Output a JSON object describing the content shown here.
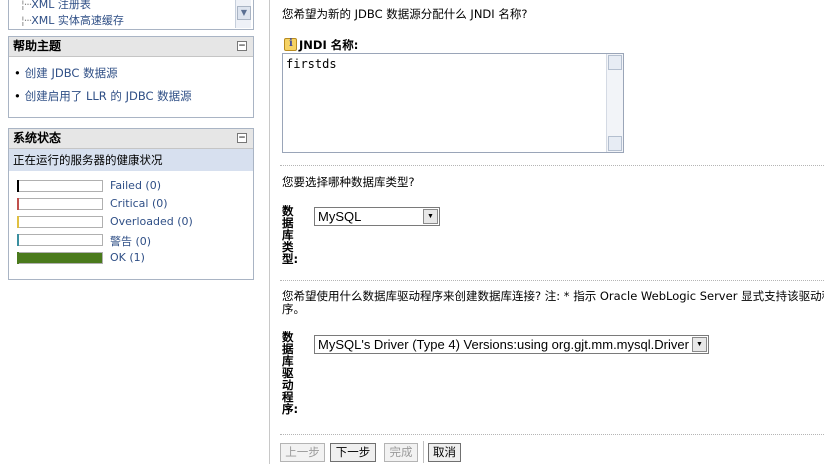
{
  "tree": {
    "items": [
      {
        "label": "XML 注册表"
      },
      {
        "label": "XML 实体高速缓存"
      }
    ]
  },
  "help": {
    "title": "帮助主题",
    "links": [
      {
        "label": "创建 JDBC 数据源"
      },
      {
        "label": "创建启用了 LLR 的 JDBC 数据源"
      }
    ]
  },
  "status": {
    "title": "系统状态",
    "subtitle": "正在运行的服务器的健康状况",
    "rows": [
      {
        "label": "Failed (0)",
        "count": 0,
        "color": "#000000"
      },
      {
        "label": "Critical (0)",
        "count": 0,
        "color": "#c0504d"
      },
      {
        "label": "Overloaded (0)",
        "count": 0,
        "color": "#e0c040"
      },
      {
        "label": "警告 (0)",
        "count": 0,
        "color": "#3a8fa0"
      },
      {
        "label": "OK (1)",
        "count": 1,
        "color": "#4a7a1c"
      }
    ]
  },
  "form": {
    "jndi_question": "您希望为新的 JDBC 数据源分配什么 JNDI 名称?",
    "jndi_label": "JNDI 名称:",
    "jndi_value": "firstds",
    "dbtype_question": "您要选择哪种数据库类型?",
    "dbtype_label": "数据库类型:",
    "dbtype_value": "MySQL",
    "driver_question": "您希望使用什么数据库驱动程序来创建数据库连接? 注: * 指示 Oracle WebLogic Server 显式支持该驱动程",
    "driver_question_cont": "序。",
    "driver_label": "数据库驱动程序:",
    "driver_value": "MySQL's Driver (Type 4) Versions:using org.gjt.mm.mysql.Driver"
  },
  "buttons": {
    "back": "上一步",
    "next": "下一步",
    "finish": "完成",
    "cancel": "取消"
  }
}
